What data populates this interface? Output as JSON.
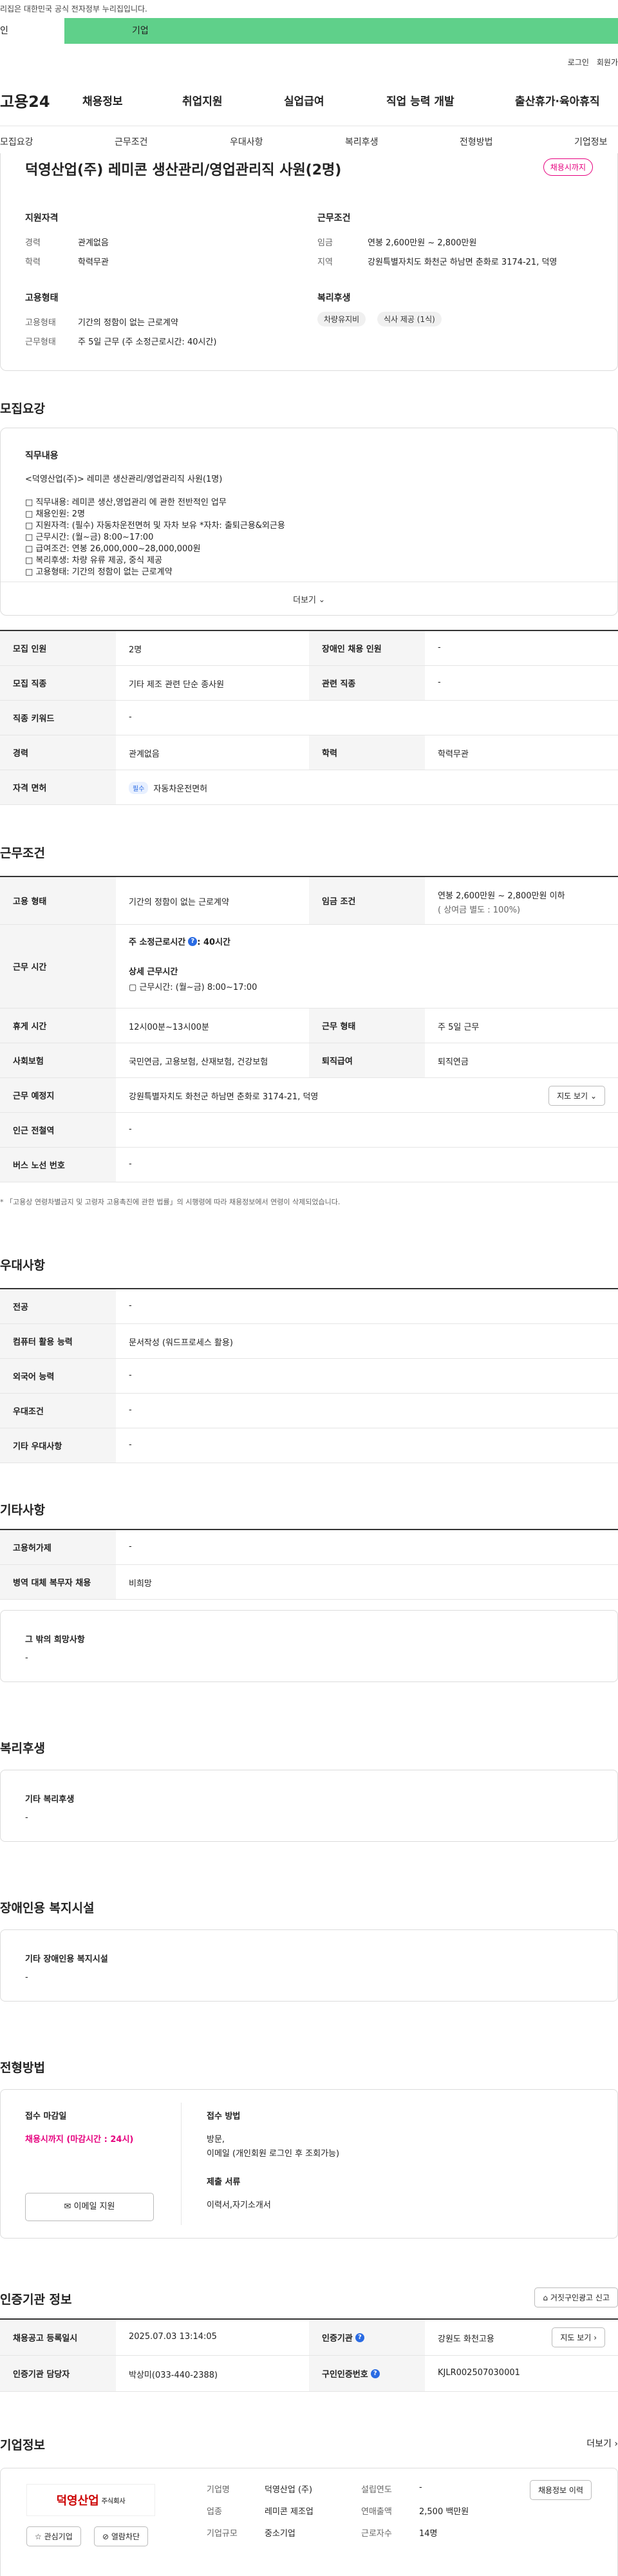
{
  "top": {
    "gov_notice": "리집은 대한민국 공식 전자정부 누리집입니다.",
    "tab_personal": "인",
    "tab_company": "기업",
    "login": "로그인",
    "signup": "회원가",
    "logo": "고용24",
    "nav": [
      "채용정보",
      "취업지원",
      "실업급여",
      "직업 능력 개발",
      "출산휴가·육아휴직"
    ],
    "subnav": [
      "모집요강",
      "근무조건",
      "우대사항",
      "복리후생",
      "전형방법",
      "기업정보"
    ]
  },
  "job": {
    "title": "덕영산업(주) 레미콘 생산관리/영업관리직 사원(2명)",
    "badge": "채용시까지",
    "qual_label": "지원자격",
    "qual_exp_k": "경력",
    "qual_exp_v": "관계없음",
    "qual_edu_k": "학력",
    "qual_edu_v": "학력무관",
    "cond_label": "근무조건",
    "cond_wage_k": "임금",
    "cond_wage_v": "연봉 2,600만원 ~ 2,800만원",
    "cond_loc_k": "지역",
    "cond_loc_v": "강원특별자치도 화천군 하남면 춘화로 3174-21, 덕영",
    "emp_label": "고용형태",
    "emp_type_k": "고용형태",
    "emp_type_v": "기간의 정함이 없는 근로계약",
    "emp_work_k": "근무형태",
    "emp_work_v": "주 5일 근무 (주 소정근로시간: 40시간)",
    "welfare_label": "복리후생",
    "welfare_chips": [
      "차량유지비",
      "식사 제공 (1식)"
    ]
  },
  "recruit": {
    "section": "모집요강",
    "duty_label": "직무내용",
    "duty_title": "<덕영산업(주)> 레미콘 생산관리/영업관리직 사원(1명)",
    "duty_lines": [
      "□ 직무내용: 레미콘 생산,영업관리 에 관한 전반적인 업무",
      "□ 채용인원: 2명",
      "□ 지원자격: (필수) 자동차운전면허 및 자차 보유  *자차: 출퇴근용&외근용",
      "□ 근무시간: (월~금) 8:00~17:00",
      "□ 급여조건: 연봉 26,000,000~28,000,000원",
      "□ 복리후생: 차량 유류 제공, 중식 제공",
      "□ 고용형태: 기간의 정함이 없는 근로계약"
    ],
    "more": "더보기",
    "rows": [
      {
        "k1": "모집 인원",
        "v1": "2명",
        "k2": "장애인 채용 인원",
        "v2": "-"
      },
      {
        "k1": "모집 직종",
        "v1": "기타 제조 관련 단순 종사원",
        "k2": "관련 직종",
        "v2": "-"
      },
      {
        "k1": "직종 키워드",
        "v1": "-"
      },
      {
        "k1": "경력",
        "v1": "관계없음",
        "k2": "학력",
        "v2": "학력무관"
      },
      {
        "k1": "자격 면허",
        "tag": "필수",
        "v1": "자동차운전면허"
      }
    ]
  },
  "work": {
    "section": "근무조건",
    "emp_k": "고용 형태",
    "emp_v": "기간의 정함이 없는 근로계약",
    "wage_k": "임금 조건",
    "wage_v1": "연봉 2,600만원 ~ 2,800만원 이하",
    "wage_v2": "( 상여금 별도 : 100%)",
    "time_k": "근무 시간",
    "time_v1": "주 소정근로시간",
    "time_v1b": ": 40시간",
    "time_v2": "상세 근무시간",
    "time_v3": "▢ 근무시간: (월~금) 8:00~17:00",
    "rest_k": "휴게 시간",
    "rest_v": "12시00분~13시00분",
    "form_k": "근무 형태",
    "form_v": "주 5일 근무",
    "ins_k": "사회보험",
    "ins_v": "국민연금, 고용보험, 산재보험, 건강보험",
    "ret_k": "퇴직급여",
    "ret_v": "퇴직연금",
    "loc_k": "근무 예정지",
    "loc_v": "강원특별자치도 화천군 하남면 춘화로 3174-21, 덕영",
    "map_btn": "지도 보기",
    "sub_k": "인근 전철역",
    "sub_v": "-",
    "bus_k": "버스 노선 번호",
    "bus_v": "-",
    "note": "* 「고용상 연령차별금지 및 고령자 고용촉진에 관한 법률」의 시행령에 따라 채용정보에서 연령이 삭제되었습니다."
  },
  "prefer": {
    "section": "우대사항",
    "rows": [
      {
        "k": "전공",
        "v": "-"
      },
      {
        "k": "컴퓨터 활용 능력",
        "v": "문서작성 (워드프로세스 활용)"
      },
      {
        "k": "외국어 능력",
        "v": "-"
      },
      {
        "k": "우대조건",
        "v": "-"
      },
      {
        "k": "기타 우대사항",
        "v": "-"
      }
    ]
  },
  "etc": {
    "section": "기타사항",
    "rows": [
      {
        "k": "고용허가제",
        "v": "-"
      },
      {
        "k": "병역 대체 복무자 채용",
        "v": "비희망"
      }
    ],
    "hope_label": "그 밖의 희망사항",
    "hope_v": "-"
  },
  "welfare": {
    "section": "복리후생",
    "label": "기타 복리후생",
    "v": "-"
  },
  "disabled": {
    "section": "장애인용 복지시설",
    "label": "기타 장애인용 복지시설",
    "v": "-"
  },
  "screen": {
    "section": "전형방법",
    "deadline_label": "접수 마감일",
    "deadline_v": "채용시까지 (마감시간 : 24시)",
    "email_btn": "이메일 지원",
    "method_label": "접수 방법",
    "method_v1": "방문,",
    "method_v2": "이메일 (개인회원 로그인 후 조회가능)",
    "docs_label": "제출 서류",
    "docs_v": "이력서,자기소개서"
  },
  "agency": {
    "section": "인증기관 정보",
    "report_btn": "거짓구인광고 신고",
    "reg_k": "채용공고 등록일시",
    "reg_v": "2025.07.03 13:14:05",
    "org_k": "인증기관",
    "org_v": "강원도 화천고용",
    "map_btn": "지도 보기",
    "mgr_k": "인증기관 담당자",
    "mgr_v": "박상미(033-440-2388)",
    "no_k": "구인인증번호",
    "no_v": "KJLR002507030001"
  },
  "company": {
    "section": "기업정보",
    "more": "더보기",
    "logo_text": "덕영산업",
    "logo_sub": "주식회사",
    "fav_btn": "관심기업",
    "block_btn": "열람차단",
    "name_k": "기업명",
    "name_v": "덕영산업 (주)",
    "year_k": "설립연도",
    "year_v": "-",
    "ind_k": "업종",
    "ind_v": "레미콘 제조업",
    "sales_k": "연매출액",
    "sales_v": "2,500 백만원",
    "size_k": "기업규모",
    "size_v": "중소기업",
    "emp_k": "근로자수",
    "emp_v": "14명",
    "jobs_btn": "채용정보 이력"
  }
}
